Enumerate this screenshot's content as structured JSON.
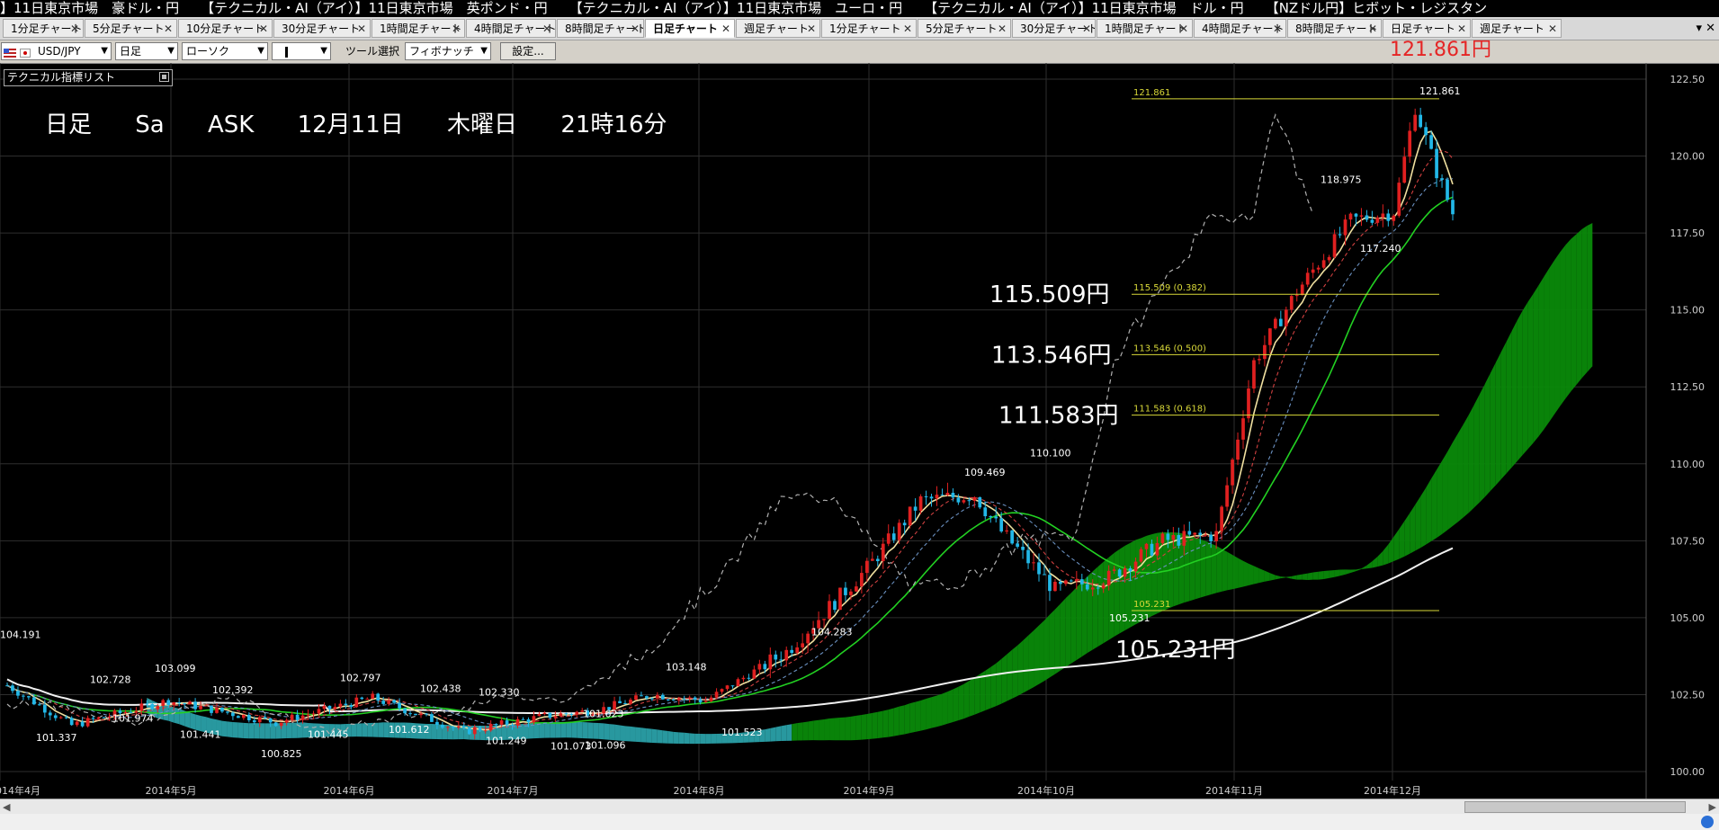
{
  "ticker": [
    "】11日東京市場　豪ドル・円",
    "【テクニカル・AI（アイ）】11日東京市場　英ポンド・円",
    "【テクニカル・AI（アイ）】11日東京市場　ユーロ・円",
    "【テクニカル・AI（アイ）】11日東京市場　ドル・円",
    "【NZドル円】ヒボット・レジスタン"
  ],
  "tabs": [
    "1分足チャート",
    "5分足チャート",
    "10分足チャート",
    "30分足チャート",
    "1時間足チャート",
    "4時間足チャート",
    "8時間足チャート",
    "日足チャート",
    "週足チャート",
    "1分足チャート",
    "5分足チャート",
    "30分足チャート",
    "1時間足チャート",
    "4時間足チャート",
    "8時間足チャート",
    "日足チャート",
    "週足チャート"
  ],
  "active_tab_index": 7,
  "toolbar": {
    "symbol": "USD/JPY",
    "timeframe": "日足",
    "chart_type": "ローソク",
    "tool_label": "ツール選択",
    "tool_value": "フィボナッチ",
    "settings_label": "設定..."
  },
  "price_label": "121.861円",
  "tech_list_label": "テクニカル指標リスト",
  "info": {
    "timeframe": "日足",
    "sa": "Sa",
    "side": "ASK",
    "date": "12月11日",
    "weekday": "木曜日",
    "time": "21時16分"
  },
  "chart_data": {
    "type": "candlestick",
    "symbol": "USD/JPY",
    "y_axis_ticks": [
      "122.50",
      "120.00",
      "117.50",
      "115.00",
      "112.50",
      "110.00",
      "107.50",
      "105.00",
      "102.50",
      "100.00"
    ],
    "ylim": [
      100.0,
      122.5
    ],
    "x_axis_ticks": [
      "2014年4月",
      "2014年5月",
      "2014年6月",
      "2014年7月",
      "2014年8月",
      "2014年9月",
      "2014年10月",
      "2014年11月",
      "2014年12月"
    ],
    "price_annotations": [
      "104.191",
      "102.728",
      "103.099",
      "102.392",
      "102.797",
      "102.438",
      "102.330",
      "101.337",
      "101.974",
      "101.441",
      "100.825",
      "101.445",
      "101.612",
      "101.249",
      "101.073",
      "101.096",
      "101.623",
      "103.148",
      "101.523",
      "104.283",
      "109.469",
      "110.100",
      "105.231",
      "118.975",
      "117.240",
      "121.861"
    ],
    "fibonacci_levels": [
      {
        "label": "121.861",
        "value": 121.861
      },
      {
        "label": "115.509 (0.382)",
        "value": 115.509
      },
      {
        "label": "113.546 (0.500)",
        "value": 113.546
      },
      {
        "label": "111.583 (0.618)",
        "value": 111.583
      },
      {
        "label": "105.231",
        "value": 105.231
      }
    ],
    "big_labels": [
      "115.509円",
      "113.546円",
      "111.583円",
      "105.231円"
    ],
    "colors": {
      "up": "#e02020",
      "down": "#22b8e8",
      "fib": "#d8d838",
      "cloud": "#0a8a0a",
      "cloud_old": "#2aa0a8"
    }
  }
}
